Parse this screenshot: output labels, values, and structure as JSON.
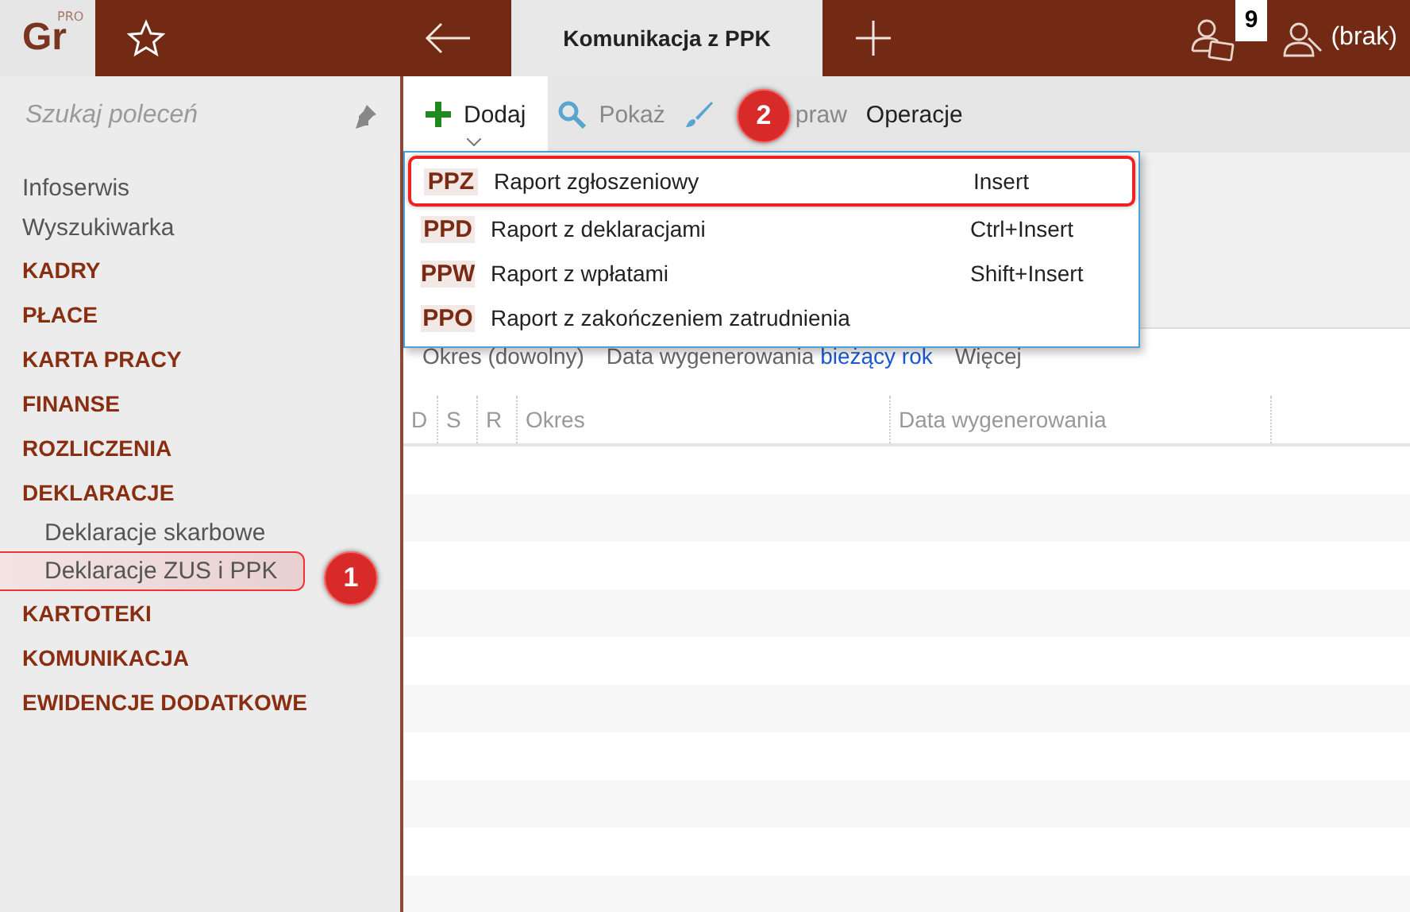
{
  "app": {
    "logo": "Gr",
    "logo_badge": "PRO"
  },
  "tabs": [
    {
      "label": "Komunikacja z PPK",
      "selected": true
    }
  ],
  "header": {
    "notification_count": "9",
    "user": "(brak)"
  },
  "sidebar": {
    "search": {
      "placeholder": "Szukaj poleceń"
    },
    "items": [
      {
        "label": "Infoserwis",
        "kind": "link"
      },
      {
        "label": "Wyszukiwarka",
        "kind": "link"
      },
      {
        "label": "KADRY",
        "kind": "category"
      },
      {
        "label": "PŁACE",
        "kind": "category"
      },
      {
        "label": "KARTA PRACY",
        "kind": "category"
      },
      {
        "label": "FINANSE",
        "kind": "category"
      },
      {
        "label": "ROZLICZENIA",
        "kind": "category"
      },
      {
        "label": "DEKLARACJE",
        "kind": "category",
        "children": [
          {
            "label": "Deklaracje skarbowe",
            "selected": false
          },
          {
            "label": "Deklaracje ZUS i PPK",
            "selected": true
          }
        ]
      },
      {
        "label": "KARTOTEKI",
        "kind": "category"
      },
      {
        "label": "KOMUNIKACJA",
        "kind": "category"
      },
      {
        "label": "EWIDENCJE DODATKOWE",
        "kind": "category"
      }
    ]
  },
  "toolbar": [
    {
      "label": "Dodaj",
      "kind": "add",
      "open": true,
      "disabled": false
    },
    {
      "label": "Pokaż",
      "kind": "show",
      "open": false,
      "disabled": true
    },
    {
      "label": "praw",
      "kind": "edit",
      "open": false,
      "disabled": true
    },
    {
      "label": "Operacje",
      "kind": "text",
      "open": false,
      "disabled": false
    }
  ],
  "menu": [
    {
      "code": "PPZ",
      "label": "Raport zgłoszeniowy",
      "shortcut": "Insert",
      "selected": true
    },
    {
      "code": "PPD",
      "label": "Raport z deklaracjami",
      "shortcut": "Ctrl+Insert",
      "selected": false
    },
    {
      "code": "PPW",
      "label": "Raport z wpłatami",
      "shortcut": "Shift+Insert",
      "selected": false
    },
    {
      "code": "PPO",
      "label": "Raport z zakończeniem zatrudnienia",
      "selected": false
    }
  ],
  "filters": [
    {
      "label": "Okres (dowolny)"
    },
    {
      "label": "Data wygenerowania",
      "value": "bieżący rok"
    },
    {
      "label": "Więcej"
    }
  ],
  "table": {
    "columns": [
      "D",
      "S",
      "R",
      "Okres",
      "Data wygenerowania"
    ]
  },
  "callouts": [
    "1",
    "2"
  ]
}
